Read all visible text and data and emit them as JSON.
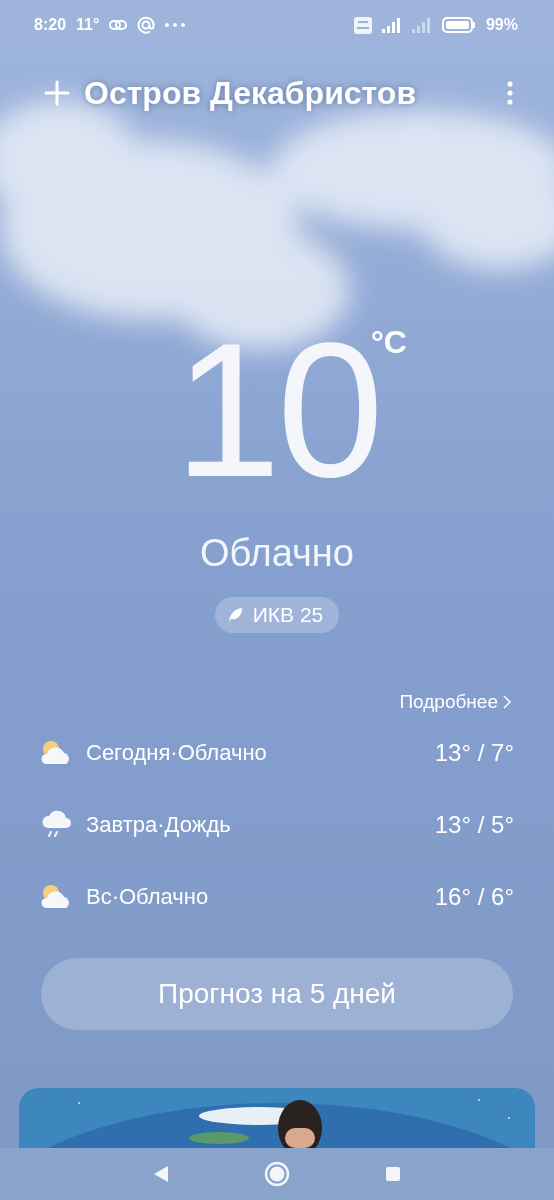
{
  "status_bar": {
    "time": "8:20",
    "temperature": "11°",
    "battery": "99%"
  },
  "header": {
    "city": "Остров Декабристов"
  },
  "current": {
    "temperature": "10",
    "unit": "°C",
    "condition": "Облачно",
    "aqi": "ИКВ 25"
  },
  "details_link": "Подробнее",
  "forecast": [
    {
      "kind": "partly_cloudy",
      "label": "Сегодня·Облачно",
      "temps": "13° / 7°"
    },
    {
      "kind": "rain",
      "label": "Завтра·Дождь",
      "temps": "13° / 5°"
    },
    {
      "kind": "partly_cloudy",
      "label": "Вс·Облачно",
      "temps": "16° / 6°"
    }
  ],
  "forecast_button": "Прогноз на 5 дней"
}
